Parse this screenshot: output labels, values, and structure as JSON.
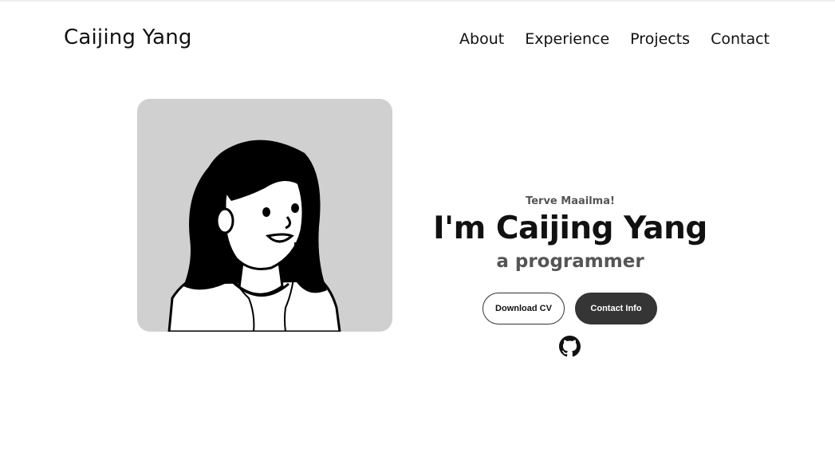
{
  "header": {
    "logo": "Caijing Yang",
    "nav": [
      "About",
      "Experience",
      "Projects",
      "Contact"
    ]
  },
  "hero": {
    "greeting": "Terve Maailma!",
    "name": "I'm Caijing Yang",
    "role": "a programmer",
    "buttons": {
      "download": "Download CV",
      "contact": "Contact Info"
    },
    "social_icon": "github-icon"
  },
  "colors": {
    "portrait_bg": "#d1d0d1",
    "dark_button": "#353535",
    "text": "#111111",
    "muted": "#555555"
  }
}
